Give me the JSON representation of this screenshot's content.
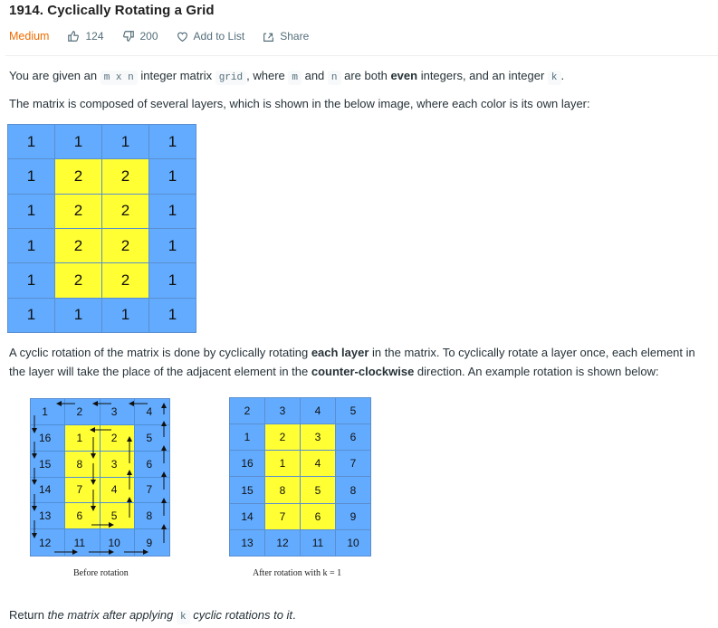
{
  "problem": {
    "number_title": "1914. Cyclically Rotating a Grid",
    "difficulty": "Medium",
    "likes": "124",
    "dislikes": "200",
    "add_to_list": "Add to List",
    "share": "Share"
  },
  "colors": {
    "difficulty": "#ef6c00",
    "layer_outer": "#62abff",
    "layer_inner": "#ffff33"
  },
  "description": {
    "p1": {
      "t1": "You are given an ",
      "c1": "m x n",
      "t2": " integer matrix ",
      "c2": "grid",
      "t3": ", where ",
      "c3": "m",
      "t4": " and ",
      "c4": "n",
      "t5": " are both ",
      "b1": "even",
      "t6": " integers, and an integer ",
      "c5": "k",
      "t7": "."
    },
    "p2": "The matrix is composed of several layers, which is shown in the below image, where each color is its own layer:",
    "p3": {
      "t1": "A cyclic rotation of the matrix is done by cyclically rotating ",
      "b1": "each layer",
      "t2": " in the matrix. To cyclically rotate a layer once, each element in",
      "t3": "the layer will take the place of the adjacent element in the ",
      "b2": "counter-clockwise",
      "t4": " direction. An example rotation is shown below:"
    },
    "p4": {
      "t1": "Return ",
      "i1": "the matrix after applying ",
      "c1": "k",
      "i2": " cyclic rotations to it",
      "t2": "."
    }
  },
  "figures": {
    "layers": {
      "values": [
        [
          1,
          1,
          1,
          1
        ],
        [
          1,
          2,
          2,
          1
        ],
        [
          1,
          2,
          2,
          1
        ],
        [
          1,
          2,
          2,
          1
        ],
        [
          1,
          2,
          2,
          1
        ],
        [
          1,
          1,
          1,
          1
        ]
      ],
      "layer": [
        [
          1,
          1,
          1,
          1
        ],
        [
          1,
          2,
          2,
          1
        ],
        [
          1,
          2,
          2,
          1
        ],
        [
          1,
          2,
          2,
          1
        ],
        [
          1,
          2,
          2,
          1
        ],
        [
          1,
          1,
          1,
          1
        ]
      ]
    },
    "before": {
      "values": [
        [
          1,
          2,
          3,
          4
        ],
        [
          16,
          1,
          2,
          5
        ],
        [
          15,
          8,
          3,
          6
        ],
        [
          14,
          7,
          4,
          7
        ],
        [
          13,
          6,
          5,
          8
        ],
        [
          12,
          11,
          10,
          9
        ]
      ],
      "caption": "Before rotation"
    },
    "after": {
      "values": [
        [
          2,
          3,
          4,
          5
        ],
        [
          1,
          2,
          3,
          6
        ],
        [
          16,
          1,
          4,
          7
        ],
        [
          15,
          8,
          5,
          8
        ],
        [
          14,
          7,
          6,
          9
        ],
        [
          13,
          12,
          11,
          10
        ]
      ],
      "caption": "After rotation with k = 1"
    }
  }
}
